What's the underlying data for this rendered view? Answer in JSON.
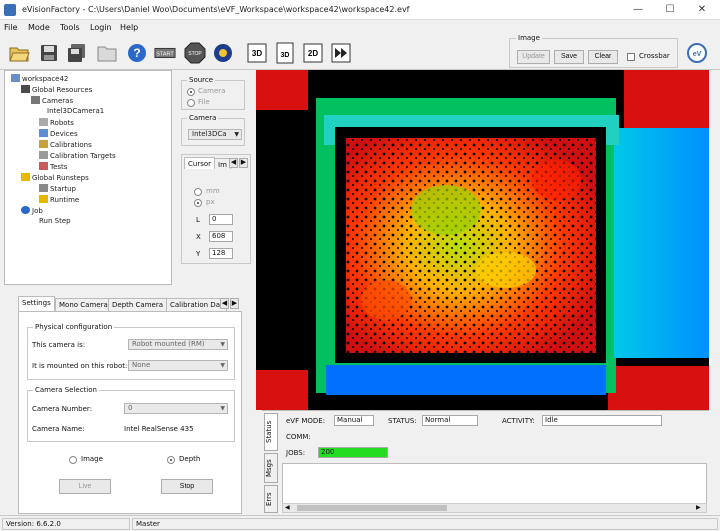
{
  "window": {
    "title": "eVisionFactory  -  C:\\Users\\Daniel Woo\\Documents\\eVF_Workspace\\workspace42\\workspace42.evf"
  },
  "menu": [
    "File",
    "Mode",
    "Tools",
    "Login",
    "Help"
  ],
  "toolbar": {
    "image_group_label": "Image",
    "update_label": "Update",
    "save_label": "Save",
    "clear_label": "Clear",
    "crossbar_label": "Crossbar",
    "btn_3d": "3D",
    "btn_2d": "2D",
    "btn_stop": "STOP",
    "btn_start": "START"
  },
  "tree": {
    "workspace": "workspace42",
    "global_resources": "Global Resources",
    "cameras": "Cameras",
    "camera_item": "Intel3DCamera1",
    "robots": "Robots",
    "devices": "Devices",
    "calibrations": "Calibrations",
    "calibration_targets": "Calibration Targets",
    "tests": "Tests",
    "global_runsteps": "Global Runsteps",
    "startup": "Startup",
    "runtime": "Runtime",
    "job": "Job",
    "run_step": "Run Step"
  },
  "source": {
    "label": "Source",
    "camera": "Camera",
    "file": "File"
  },
  "camera": {
    "label": "Camera",
    "value": "Intel3DCa"
  },
  "cursor": {
    "tab1": "Cursor",
    "tab2": "Im",
    "mm": "mm",
    "px": "px",
    "L": "L",
    "L_val": "0",
    "X": "X",
    "X_val": "608",
    "Y": "Y",
    "Y_val": "128"
  },
  "settings": {
    "tabs": [
      "Settings",
      "Mono Camera",
      "Depth Camera",
      "Calibration Dat"
    ],
    "physical_label": "Physical configuration",
    "camera_is_label": "This camera is:",
    "camera_is_value": "Robot mounted (RM)",
    "mounted_on_label": "It is mounted on this robot:",
    "mounted_on_value": "None",
    "selection_label": "Camera Selection",
    "number_label": "Camera Number:",
    "number_value": "0",
    "name_label": "Camera Name:",
    "name_value": "Intel RealSense 435",
    "image_radio": "Image",
    "depth_radio": "Depth",
    "live_label": "Live",
    "stop_label": "Stop"
  },
  "status": {
    "vtabs": [
      "Status",
      "Msgs",
      "Errs"
    ],
    "mode_label": "eVF MODE:",
    "mode_value": "Manual",
    "status_label": "STATUS:",
    "status_value": "Normal",
    "activity_label": "ACTIVITY:",
    "activity_value": "Idle",
    "comm_label": "COMM:",
    "jobs_label": "JOBS:",
    "jobs_value": "200",
    "jobs_color": "#22dd22"
  },
  "statusbar": {
    "version": "Version: 6.6.2.0",
    "user": "Master"
  },
  "colors": {
    "accent": "#3a6fb5",
    "jobs_green": "#22dd22"
  }
}
